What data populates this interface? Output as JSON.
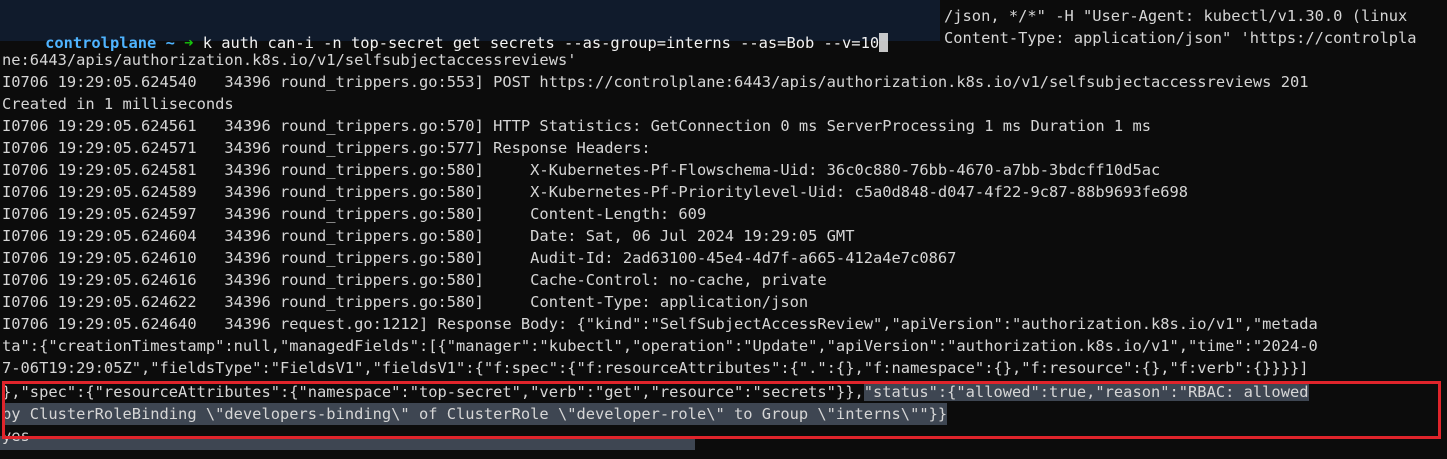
{
  "prompt": {
    "host": "controlplane",
    "tilde": "~",
    "arrow": "➜",
    "command": "k auth can-i -n top-secret get secrets --as-group=interns --as=Bob --v=10"
  },
  "overflow_top": {
    "line1": "/json, */*\" -H \"User-Agent: kubectl/v1.30.0 (linux",
    "line2": "Content-Type: application/json\" 'https://controlpla"
  },
  "lines": [
    "ne:6443/apis/authorization.k8s.io/v1/selfsubjectaccessreviews'",
    "I0706 19:29:05.624540   34396 round_trippers.go:553] POST https://controlplane:6443/apis/authorization.k8s.io/v1/selfsubjectaccessreviews 201",
    "Created in 1 milliseconds",
    "I0706 19:29:05.624561   34396 round_trippers.go:570] HTTP Statistics: GetConnection 0 ms ServerProcessing 1 ms Duration 1 ms",
    "I0706 19:29:05.624571   34396 round_trippers.go:577] Response Headers:",
    "I0706 19:29:05.624581   34396 round_trippers.go:580]     X-Kubernetes-Pf-Flowschema-Uid: 36c0c880-76bb-4670-a7bb-3bdcff10d5ac",
    "I0706 19:29:05.624589   34396 round_trippers.go:580]     X-Kubernetes-Pf-Prioritylevel-Uid: c5a0d848-d047-4f22-9c87-88b9693fe698",
    "I0706 19:29:05.624597   34396 round_trippers.go:580]     Content-Length: 609",
    "I0706 19:29:05.624604   34396 round_trippers.go:580]     Date: Sat, 06 Jul 2024 19:29:05 GMT",
    "I0706 19:29:05.624610   34396 round_trippers.go:580]     Audit-Id: 2ad63100-45e4-4d7f-a665-412a4e7c0867",
    "I0706 19:29:05.624616   34396 round_trippers.go:580]     Cache-Control: no-cache, private",
    "I0706 19:29:05.624622   34396 round_trippers.go:580]     Content-Type: application/json",
    "I0706 19:29:05.624640   34396 request.go:1212] Response Body: {\"kind\":\"SelfSubjectAccessReview\",\"apiVersion\":\"authorization.k8s.io/v1\",\"metada",
    "ta\":{\"creationTimestamp\":null,\"managedFields\":[{\"manager\":\"kubectl\",\"operation\":\"Update\",\"apiVersion\":\"authorization.k8s.io/v1\",\"time\":\"2024-0",
    "7-06T19:29:05Z\",\"fieldsType\":\"FieldsV1\",\"fieldsV1\":{\"f:spec\":{\"f:resourceAttributes\":{\".\":{},\"f:namespace\":{},\"f:resource\":{},\"f:verb\":{}}}}]"
  ],
  "highlighted": {
    "line1_plain": "},\"spec\":{\"resourceAttributes\":{\"namespace\":\"top-secret\",\"verb\":\"get\",\"resource\":\"secrets\"}},",
    "line1_status": "\"status\":{\"allowed\":true,\"reason\":\"RBAC: allowed",
    "line2": "by ClusterRoleBinding \\\"developers-binding\\\" of ClusterRole \\\"developer-role\\\" to Group \\\"interns\\\"\"}}",
    "result": "yes"
  },
  "colors": {
    "background": "#0c0c0c",
    "prompt_host": "#4fb4ff",
    "prompt_arrow": "#16c60c",
    "highlight_border": "#e0242b",
    "selection": "#3e4652"
  }
}
